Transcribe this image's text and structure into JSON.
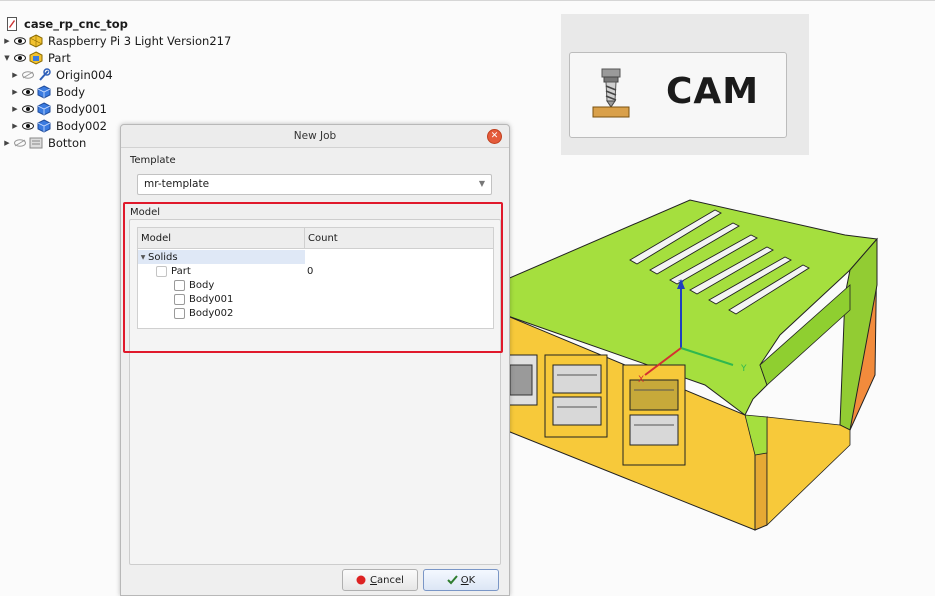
{
  "tree": {
    "root": "case_rp_cnc_top",
    "items": [
      {
        "label": "Raspberry Pi 3 Light Version217",
        "icon": "part-feature-icon"
      },
      {
        "label": "Part",
        "icon": "part-icon"
      },
      {
        "label": "Origin004",
        "icon": "origin-icon"
      },
      {
        "label": "Body",
        "icon": "body-icon"
      },
      {
        "label": "Body001",
        "icon": "body-icon"
      },
      {
        "label": "Body002",
        "icon": "body-icon"
      },
      {
        "label": "Botton",
        "icon": "group-icon"
      }
    ]
  },
  "cam": {
    "label": "CAM",
    "icon": "cam-tool-icon"
  },
  "dialog": {
    "title": "New Job",
    "template_label": "Template",
    "template_value": "mr-template",
    "model_label": "Model",
    "columns": [
      "Model",
      "Count"
    ],
    "rows": [
      {
        "label": "Solids"
      },
      {
        "label": "Part",
        "count": "0"
      },
      {
        "label": "Body"
      },
      {
        "label": "Body001"
      },
      {
        "label": "Body002"
      }
    ],
    "cancel_mnemonic": "C",
    "cancel_rest": "ancel",
    "ok_mnemonic": "O",
    "ok_rest": "K"
  },
  "axes": {
    "z": "Z",
    "y": "Y",
    "x": "X"
  },
  "colors": {
    "highlight": "#e0192b",
    "lid": "#a5df3e",
    "base": "#f7c93a",
    "side": "#f28b3c"
  }
}
